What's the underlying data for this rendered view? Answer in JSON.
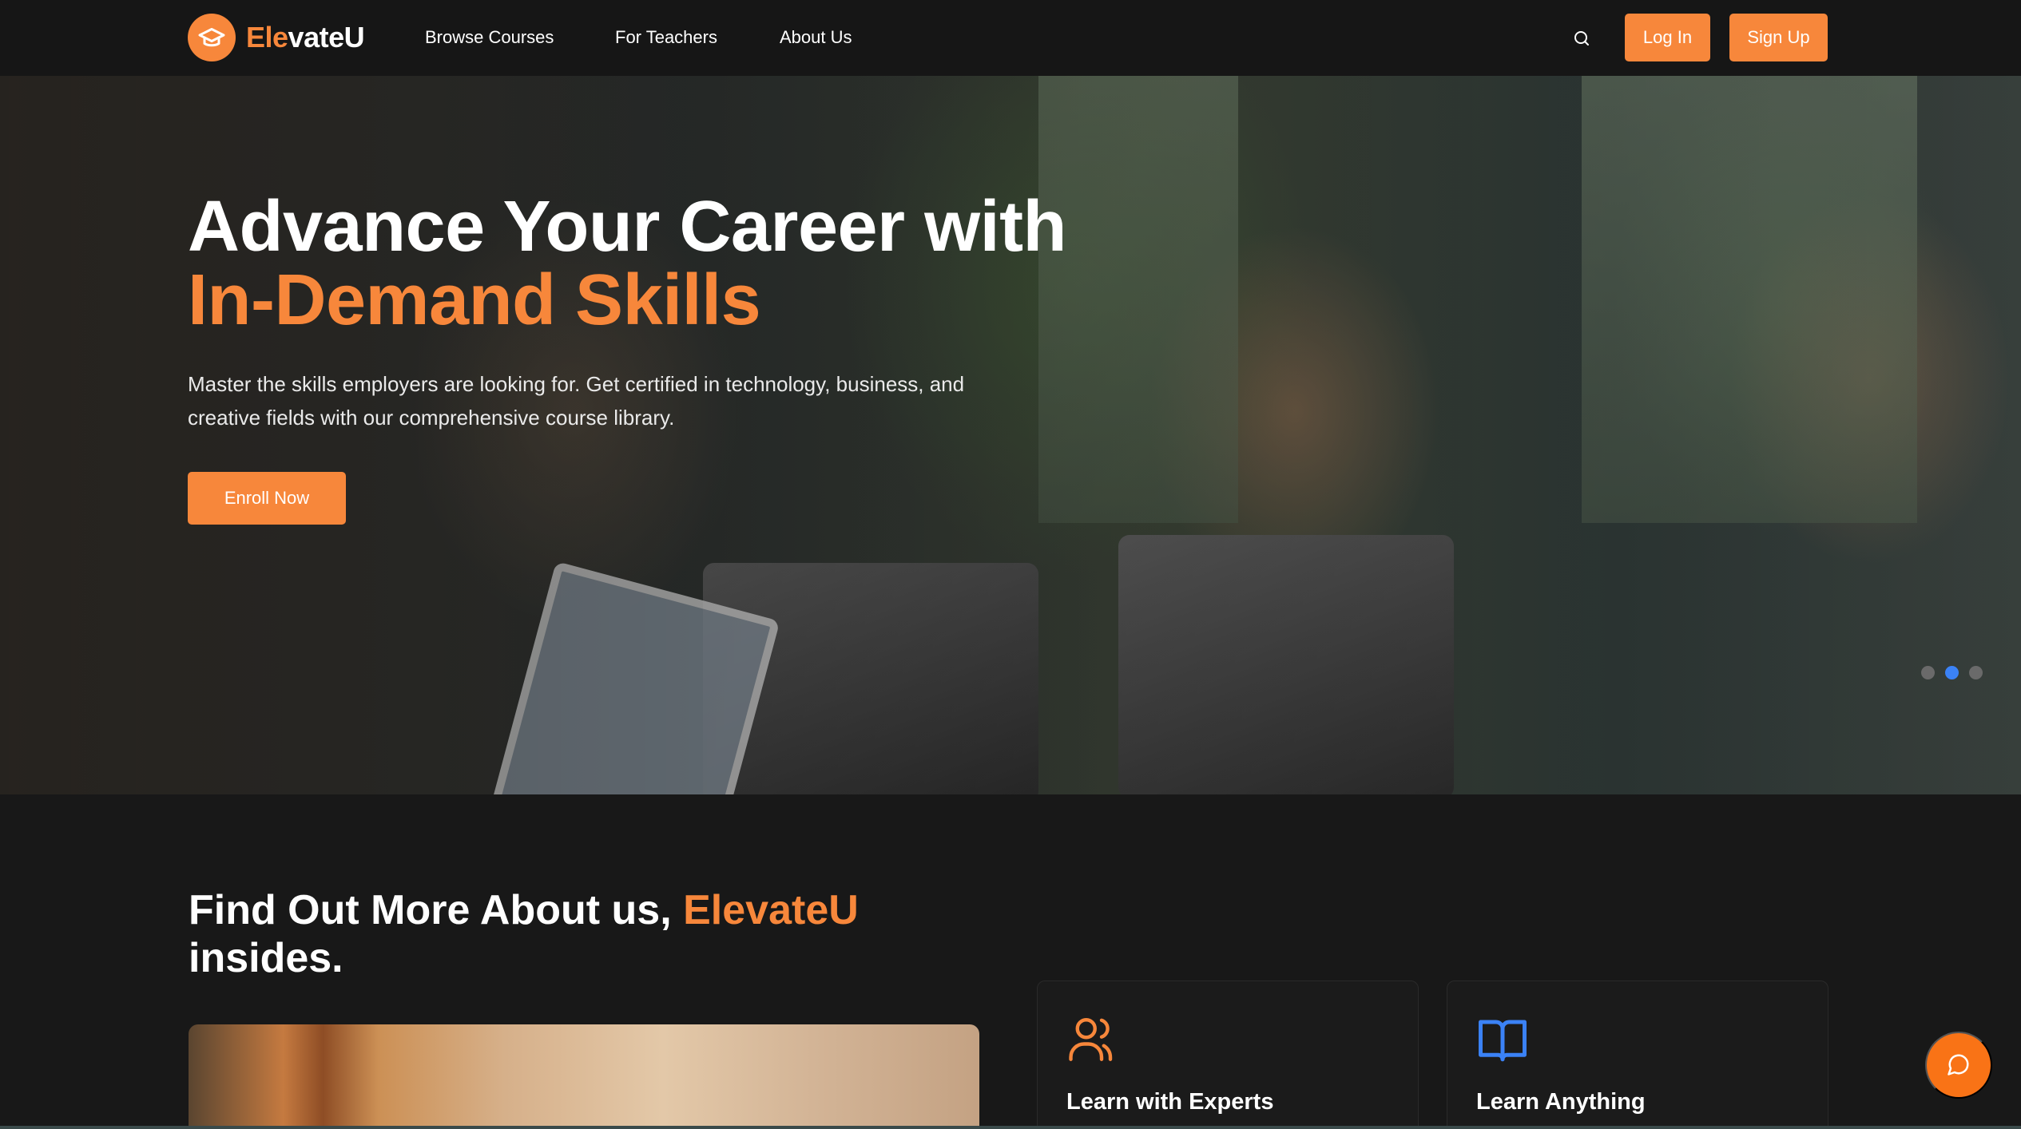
{
  "brand": {
    "name_accent": "Ele",
    "name_rest": "vateU",
    "accent_color": "#f7873b"
  },
  "nav": {
    "links": [
      "Browse Courses",
      "For Teachers",
      "About Us"
    ],
    "login": "Log In",
    "signup": "Sign Up"
  },
  "hero": {
    "title_line1": "Advance Your Career with",
    "title_line2": "In-Demand Skills",
    "subtitle": "Master the skills employers are looking for. Get certified in technology, business, and creative fields with our comprehensive course library.",
    "cta": "Enroll Now",
    "slides": {
      "count": 3,
      "active_index": 1
    }
  },
  "about": {
    "title_prefix": "Find Out More About us, ",
    "title_brand": "ElevateU",
    "title_suffix": "insides.",
    "features": [
      {
        "title": "Learn with Experts",
        "icon": "users-icon",
        "icon_color": "#f7873b"
      },
      {
        "title": "Learn Anything",
        "icon": "book-open-icon",
        "icon_color": "#3b82f6"
      }
    ]
  },
  "chat": {
    "icon": "chat-bubble-icon",
    "color": "#f97316"
  }
}
